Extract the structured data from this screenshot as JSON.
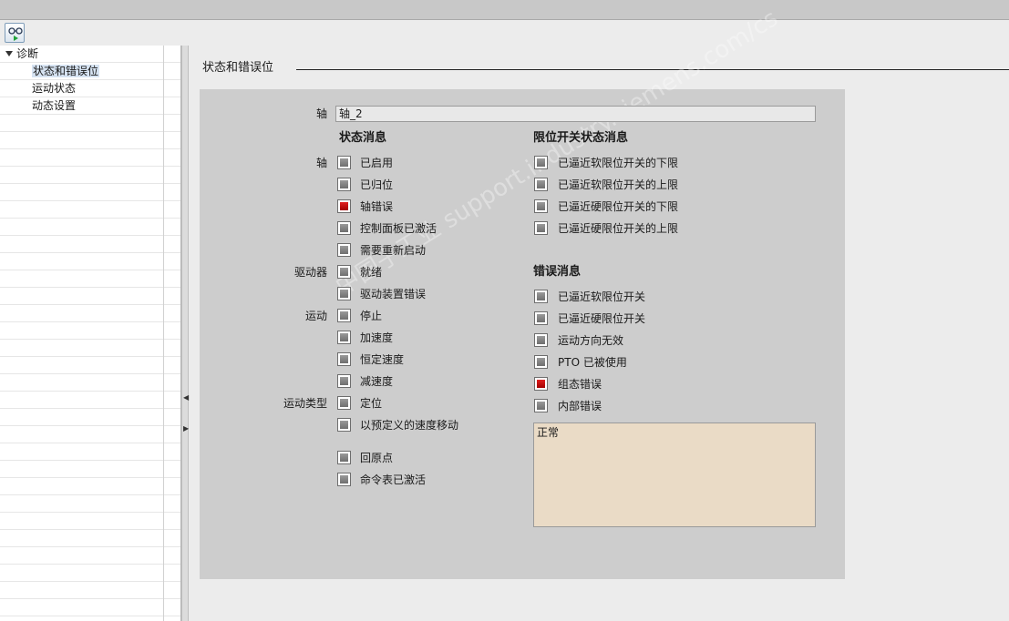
{
  "nav": {
    "root": "诊断",
    "items": [
      "状态和错误位",
      "运动状态",
      "动态设置"
    ]
  },
  "section_title": "状态和错误位",
  "axis": {
    "label": "轴",
    "value": "轴_2"
  },
  "status": {
    "header": "状态消息",
    "groups": {
      "axis": "轴",
      "drive": "驱动器",
      "motion": "运动",
      "motion_type": "运动类型"
    },
    "items": [
      {
        "label": "已启用",
        "active": false
      },
      {
        "label": "已归位",
        "active": false
      },
      {
        "label": "轴错误",
        "active": true
      },
      {
        "label": "控制面板已激活",
        "active": false
      },
      {
        "label": "需要重新启动",
        "active": false
      },
      {
        "label": "就绪",
        "active": false
      },
      {
        "label": "驱动装置错误",
        "active": false
      },
      {
        "label": "停止",
        "active": false
      },
      {
        "label": "加速度",
        "active": false
      },
      {
        "label": "恒定速度",
        "active": false
      },
      {
        "label": "减速度",
        "active": false
      },
      {
        "label": "定位",
        "active": false
      },
      {
        "label": "以预定义的速度移动",
        "active": false
      },
      {
        "label": "回原点",
        "active": false
      },
      {
        "label": "命令表已激活",
        "active": false
      }
    ]
  },
  "limits": {
    "header": "限位开关状态消息",
    "items": [
      {
        "label": "已逼近软限位开关的下限",
        "active": false
      },
      {
        "label": "已逼近软限位开关的上限",
        "active": false
      },
      {
        "label": "已逼近硬限位开关的下限",
        "active": false
      },
      {
        "label": "已逼近硬限位开关的上限",
        "active": false
      }
    ]
  },
  "errors": {
    "header": "错误消息",
    "items": [
      {
        "label": "已逼近软限位开关",
        "active": false
      },
      {
        "label": "已逼近硬限位开关",
        "active": false
      },
      {
        "label": "运动方向无效",
        "active": false
      },
      {
        "label": "PTO 已被使用",
        "active": false
      },
      {
        "label": "组态错误",
        "active": true
      },
      {
        "label": "内部错误",
        "active": false
      }
    ]
  },
  "message_box": "正常",
  "watermark": "中国子工业 support.industry.siemens.com/cs",
  "colors": {
    "active": "#c40000",
    "inactive": "#808080",
    "panel": "#cdcdcd",
    "message_bg": "#eadbc6"
  }
}
